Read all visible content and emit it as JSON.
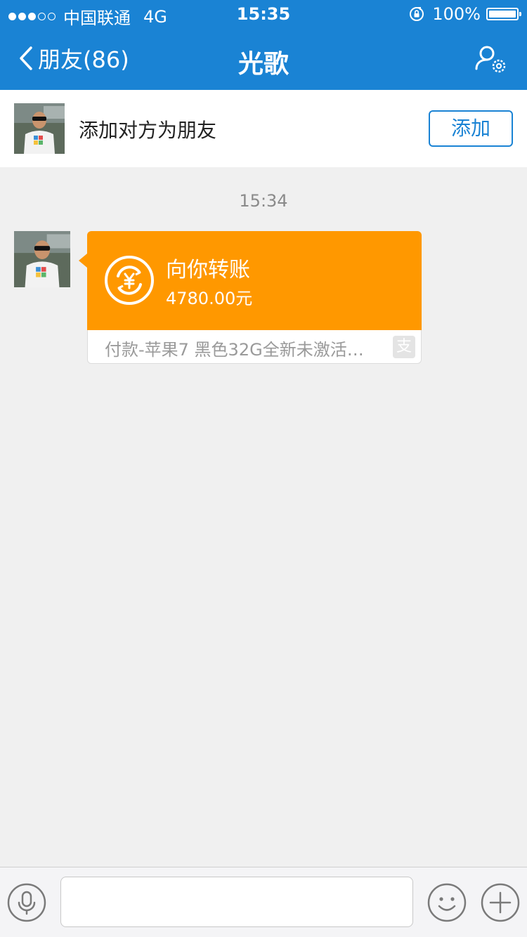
{
  "status_bar": {
    "carrier": "中国联通",
    "network": "4G",
    "time": "15:35",
    "battery": "100%",
    "signal_filled": 3,
    "signal_total": 5
  },
  "nav": {
    "back_label": "朋友(86)",
    "title": "光歌",
    "back_icon": "chevron-left-icon",
    "profile_icon": "profile-settings-icon"
  },
  "add_friend": {
    "text": "添加对方为朋友",
    "button_label": "添加"
  },
  "chat": {
    "timestamp": "15:34",
    "transfer": {
      "title": "向你转账",
      "amount": "4780.00元",
      "note": "付款-苹果7 黑色32G全新未激活…",
      "brand_glyph": "支",
      "icon": "yuan-transfer-icon"
    }
  },
  "input_bar": {
    "voice_icon": "microphone-icon",
    "emoji_icon": "smiley-icon",
    "more_icon": "plus-circle-icon",
    "value": "",
    "placeholder": ""
  },
  "colors": {
    "brand_blue": "#1a83d4",
    "transfer_orange": "#ff9800",
    "background": "#f0f0f0"
  }
}
